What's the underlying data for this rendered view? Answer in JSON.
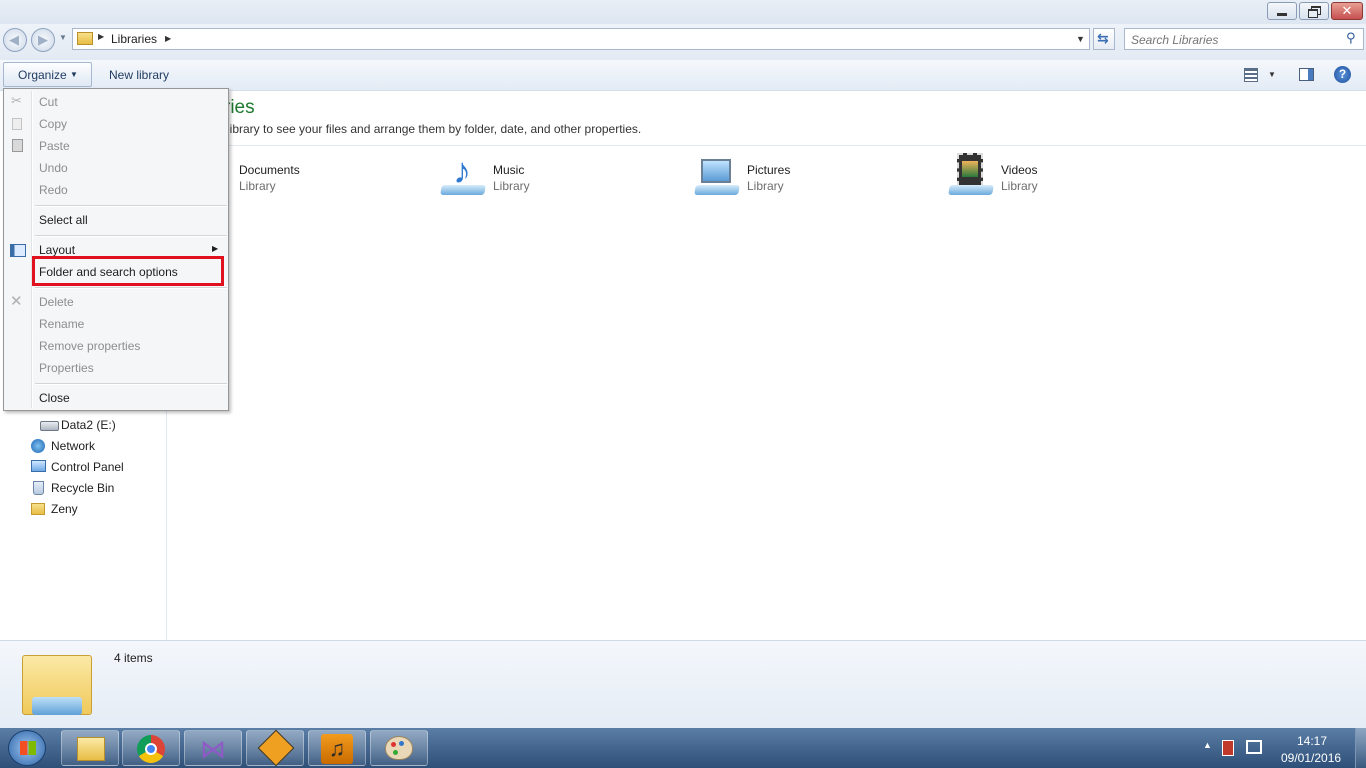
{
  "window": {
    "address": {
      "segment": "Libraries"
    },
    "search_placeholder": "Search Libraries"
  },
  "toolbar": {
    "organize_label": "Organize",
    "new_library_label": "New library"
  },
  "content": {
    "heading": "ries",
    "description": "library to see your files and arrange them by folder, date, and other properties.",
    "libraries": [
      {
        "name": "Documents",
        "type": "Library",
        "icon": "documents-icon"
      },
      {
        "name": "Music",
        "type": "Library",
        "icon": "music-icon"
      },
      {
        "name": "Pictures",
        "type": "Library",
        "icon": "pictures-icon"
      },
      {
        "name": "Videos",
        "type": "Library",
        "icon": "videos-icon"
      }
    ]
  },
  "navpane": {
    "items": [
      {
        "label": "Data2 (E:)",
        "icon": "drive-icon"
      },
      {
        "label": "Network",
        "icon": "network-icon"
      },
      {
        "label": "Control Panel",
        "icon": "control-panel-icon"
      },
      {
        "label": "Recycle Bin",
        "icon": "recycle-bin-icon"
      },
      {
        "label": "Zeny",
        "icon": "folder-icon"
      }
    ]
  },
  "menu": {
    "cut": "Cut",
    "copy": "Copy",
    "paste": "Paste",
    "undo": "Undo",
    "redo": "Redo",
    "select_all": "Select all",
    "layout": "Layout",
    "folder_search_options": "Folder and search options",
    "delete": "Delete",
    "rename": "Rename",
    "remove_properties": "Remove properties",
    "properties": "Properties",
    "close": "Close"
  },
  "details": {
    "count": "4 items"
  },
  "tray": {
    "time": "14:17",
    "date": "09/01/2016"
  },
  "colors": {
    "heading": "#1e7a2e",
    "highlight": "#e0101e",
    "taskbar": "#2e4f77"
  }
}
